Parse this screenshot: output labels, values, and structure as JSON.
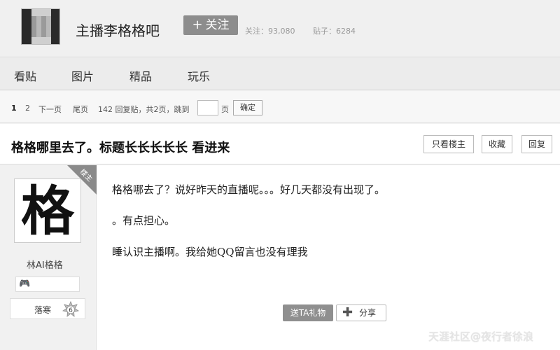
{
  "header": {
    "bar_name": "主播李格格吧",
    "follow_label": "关注",
    "follow_plus": "+",
    "follow_count_label": "关注：93,080",
    "post_count_label": "贴子：6284"
  },
  "nav": {
    "items": [
      {
        "label": "看贴"
      },
      {
        "label": "图片"
      },
      {
        "label": "精品"
      },
      {
        "label": "玩乐"
      }
    ]
  },
  "pager": {
    "page1": "1",
    "page2": "2",
    "next": "下一页",
    "last": "尾页",
    "summary": "142 回复贴，共2页，跳到",
    "page_unit": "页",
    "confirm": "确定",
    "jump_value": ""
  },
  "thread": {
    "title": "格格哪里去了。标题长长长长长  看进来",
    "only_op": "只看楼主",
    "favorite": "收藏",
    "reply": "回复"
  },
  "post": {
    "op_tag": "楼主",
    "avatar_char": "格",
    "author": "林AI格格",
    "level_title": "落寒",
    "level_number": "6",
    "lines": [
      "格格哪去了？说好昨天的直播呢。。。好几天都没有出现了。",
      "。有点担心。",
      "睡认识主播啊。我给她QQ留言也没有理我"
    ],
    "gift_label": "送TA礼物",
    "share_label": "分享"
  },
  "watermark": "天涯社区@夜行者徐浪",
  "icons": {
    "avatar": "user-avatar",
    "game": "gamepad-icon",
    "level_badge": "level-badge-icon",
    "share": "plus-icon"
  }
}
